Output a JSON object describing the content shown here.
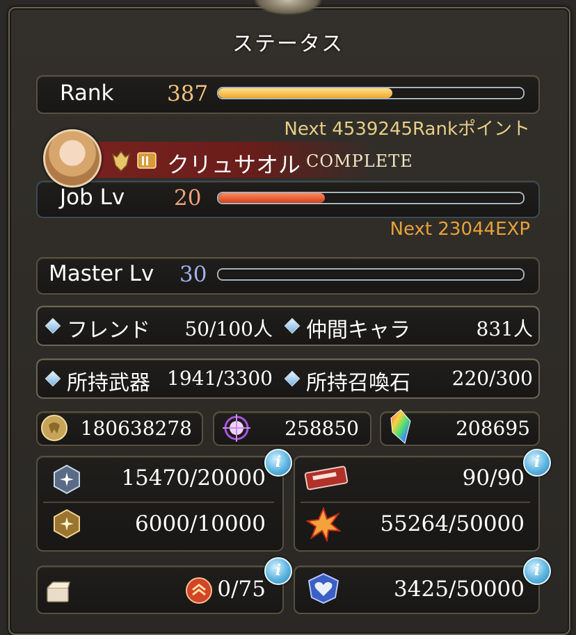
{
  "title": "ステータス",
  "rank": {
    "label": "Rank",
    "value": "387",
    "progress": 0.57,
    "next": "Next 4539245Rankポイント"
  },
  "job": {
    "name": "クリュサオル",
    "status": "COMPLETE",
    "label": "Job Lv",
    "value": "20",
    "progress": 0.35,
    "next": "Next 23044EXP"
  },
  "master": {
    "label": "Master Lv",
    "value": "30",
    "progress": 0.0
  },
  "friends": {
    "label": "フレンド",
    "value": "50/100人"
  },
  "companions": {
    "label": "仲間キャラ",
    "value": "831人"
  },
  "weapons": {
    "label": "所持武器",
    "value": "1941/3300"
  },
  "summons": {
    "label": "所持召喚石",
    "value": "220/300"
  },
  "currency": {
    "rupie": "180638278",
    "crystal_shards": "258850",
    "crystals": "208695"
  },
  "stats": {
    "renown": "15470/20000",
    "prestige": "6000/10000",
    "tickets": "90/90",
    "burst": "55264/50000",
    "chest": "0/75",
    "heart": "3425/50000"
  },
  "info_glyph": "i",
  "colors": {
    "rank_bar": "#f0b43c",
    "job_bar": "#e05a2a",
    "accent_text": "#e4cf86",
    "exp_text": "#e6a23c"
  }
}
